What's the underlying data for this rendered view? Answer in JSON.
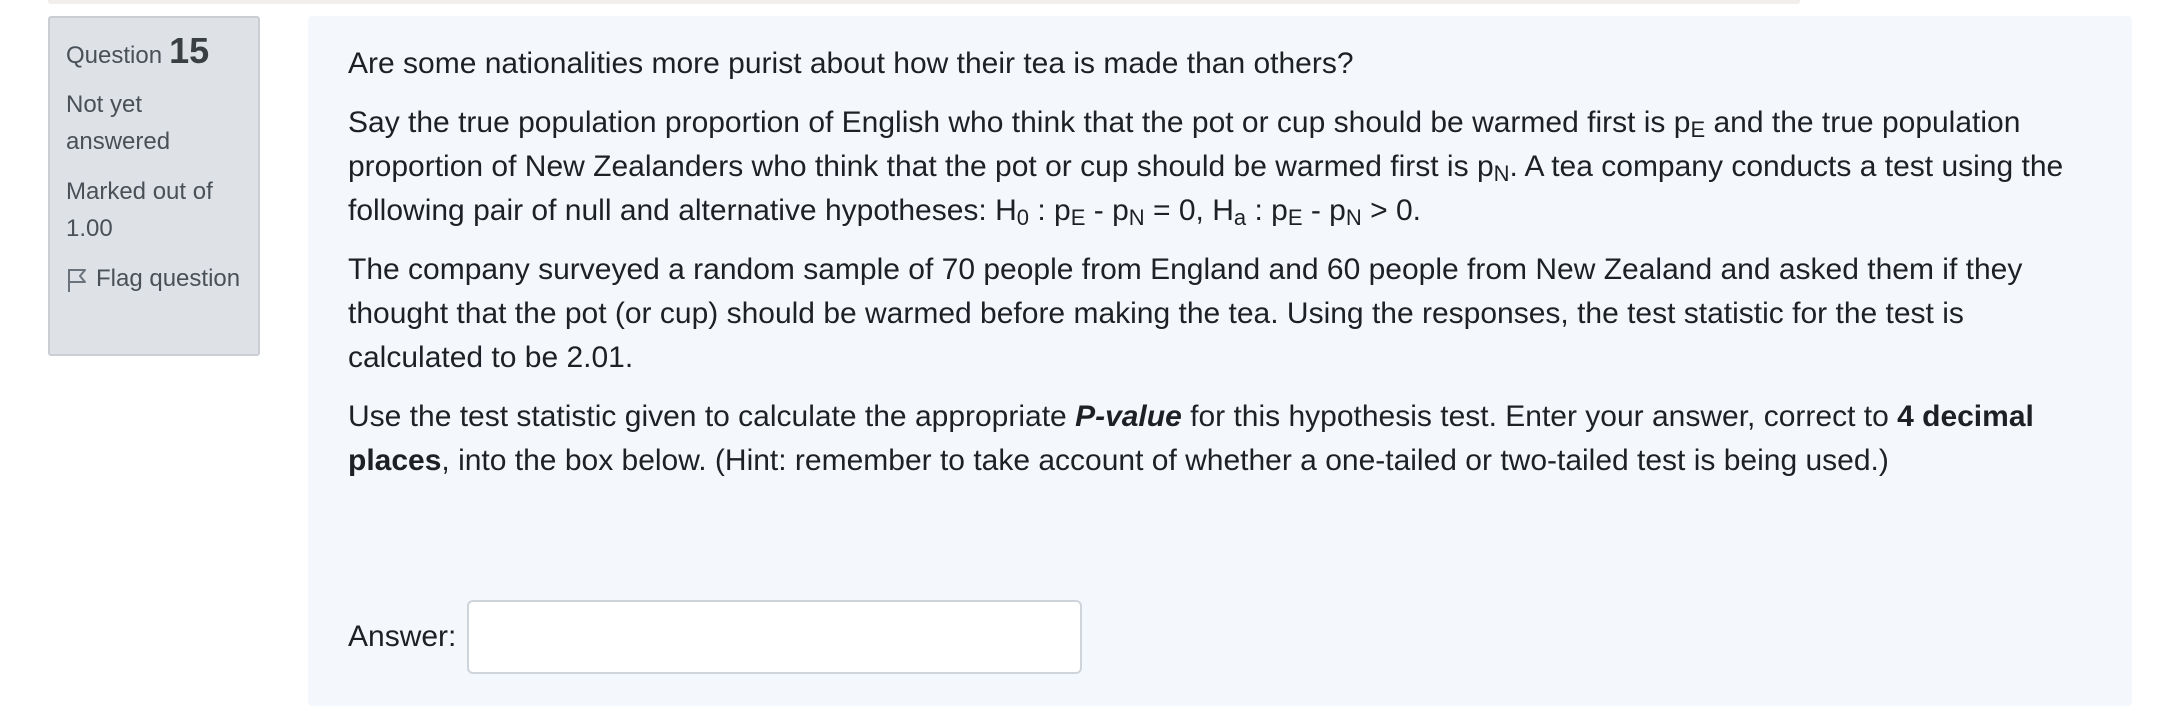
{
  "question_info": {
    "label": "Question",
    "number": "15",
    "status": "Not yet answered",
    "marked_out_of": "Marked out of 1.00",
    "flag_label": "Flag question",
    "flag_icon": "flag-icon"
  },
  "question_text": {
    "p1": "Are some nationalities more purist about how their tea is made than others?",
    "p2": {
      "t1": "Say the true population proportion of English who think that the pot or cup should be warmed first is ",
      "pE_base": "p",
      "pE_sub": "E",
      "t2": " and the true population proportion of New Zealanders who think that the pot or cup should be warmed first is ",
      "pN_base": "p",
      "pN_sub": "N",
      "t3": ". A tea company conducts a test using the following pair of null and alternative hypotheses: ",
      "H0_base": "H",
      "H0_sub": "0",
      "t4": " : ",
      "h0_pE_base": "p",
      "h0_pE_sub": "E",
      "t5": " - ",
      "h0_pN_base": "p",
      "h0_pN_sub": "N",
      "t6": " = 0, ",
      "Ha_base": "H",
      "Ha_sub": "a",
      "t7": " : ",
      "ha_pE_base": "p",
      "ha_pE_sub": "E",
      "t8": " - ",
      "ha_pN_base": "p",
      "ha_pN_sub": "N",
      "t9": " > 0."
    },
    "p3": "The company surveyed a random sample of 70 people from England and 60 people from New Zealand and asked them if they thought that the pot (or cup) should be warmed before making the tea. Using the responses, the test statistic for the test is calculated to be 2.01.",
    "p4": {
      "t1": "Use the test statistic given to calculate the appropriate ",
      "pvalue": "P-value",
      "t2": " for this hypothesis test. Enter your answer, correct to ",
      "decimals": "4 decimal places",
      "t3": ", into the box below. (Hint: remember to take account of whether a one-tailed or two-tailed test is being used.)"
    }
  },
  "answer": {
    "label": "Answer:",
    "value": ""
  }
}
